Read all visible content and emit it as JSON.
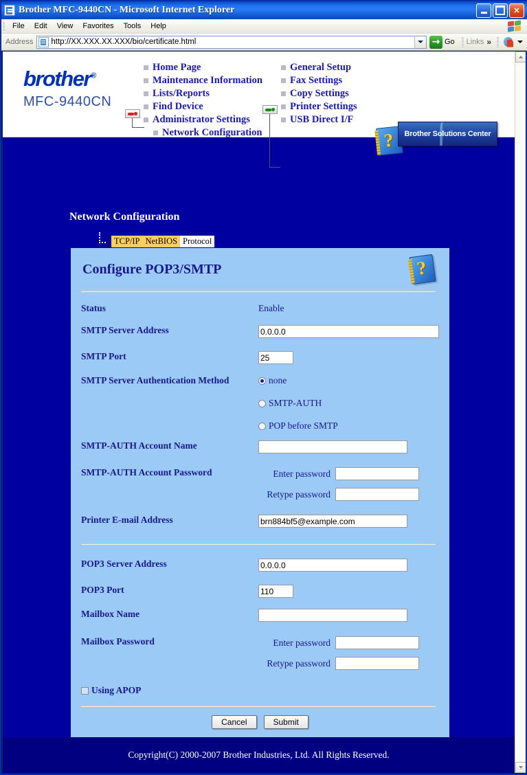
{
  "window": {
    "title": "Brother MFC-9440CN - Microsoft Internet Explorer",
    "minimize_label": "",
    "maximize_label": "",
    "close_label": "✕"
  },
  "menubar": {
    "items": [
      "File",
      "Edit",
      "View",
      "Favorites",
      "Tools",
      "Help"
    ]
  },
  "addressbar": {
    "label": "Address",
    "url": "http://XX.XXX.XX.XXX/bio/certificate.html",
    "go_label": "Go",
    "links_label": "Links",
    "overflow_label": "»"
  },
  "site_header": {
    "logo": "brother",
    "logo_registered": "®",
    "model": "MFC-9440CN",
    "nav_column_1": [
      "Home Page",
      "Maintenance Information",
      "Lists/Reports",
      "Find Device",
      "Administrator Settings",
      "Network Configuration"
    ],
    "nav_column_2": [
      "General Setup",
      "Fax Settings",
      "Copy Settings",
      "Printer Settings",
      "USB Direct I/F"
    ],
    "solutions_center": "Brother Solutions Center",
    "solutions_center_glyph": "∫"
  },
  "page": {
    "title": "Network Configuration",
    "tabs": [
      {
        "label": "TCP/IP",
        "selected": true
      },
      {
        "label": "NetBIOS",
        "selected": true
      },
      {
        "label": "Protocol",
        "selected": false
      }
    ]
  },
  "form": {
    "heading": "Configure POP3/SMTP",
    "help_icon_glyph": "?",
    "status_label": "Status",
    "status_value": "Enable",
    "smtp_server_address_label": "SMTP Server Address",
    "smtp_server_address_value": "0.0.0.0",
    "smtp_port_label": "SMTP Port",
    "smtp_port_value": "25",
    "smtp_auth_method_label": "SMTP Server Authentication Method",
    "smtp_auth_options": [
      {
        "label": "none",
        "selected": true
      },
      {
        "label": "SMTP-AUTH",
        "selected": false
      },
      {
        "label": "POP before SMTP",
        "selected": false
      }
    ],
    "smtp_auth_account_name_label": "SMTP-AUTH Account Name",
    "smtp_auth_account_name_value": "",
    "smtp_auth_account_password_label": "SMTP-AUTH Account Password",
    "enter_password_label": "Enter password",
    "retype_password_label": "Retype password",
    "smtp_enter_password_value": "",
    "smtp_retype_password_value": "",
    "printer_email_label": "Printer E-mail Address",
    "printer_email_value": "brn884bf5@example.com",
    "pop3_server_address_label": "POP3 Server Address",
    "pop3_server_address_value": "0.0.0.0",
    "pop3_port_label": "POP3 Port",
    "pop3_port_value": "110",
    "mailbox_name_label": "Mailbox Name",
    "mailbox_name_value": "",
    "mailbox_password_label": "Mailbox Password",
    "mailbox_enter_password_value": "",
    "mailbox_retype_password_value": "",
    "using_apop_label": "Using APOP",
    "using_apop_checked": false,
    "cancel_label": "Cancel",
    "submit_label": "Submit"
  },
  "footer": {
    "copyright": "Copyright(C) 2000-2007 Brother Industries, Ltd. All Rights Reserved."
  },
  "colors": {
    "page_background": "#0000a0",
    "panel_background": "#9ccaf7",
    "footer_background": "#000080",
    "label_text": "#18188c",
    "tab_selected": "#ffcc66",
    "link_text": "#1a1ab0"
  }
}
